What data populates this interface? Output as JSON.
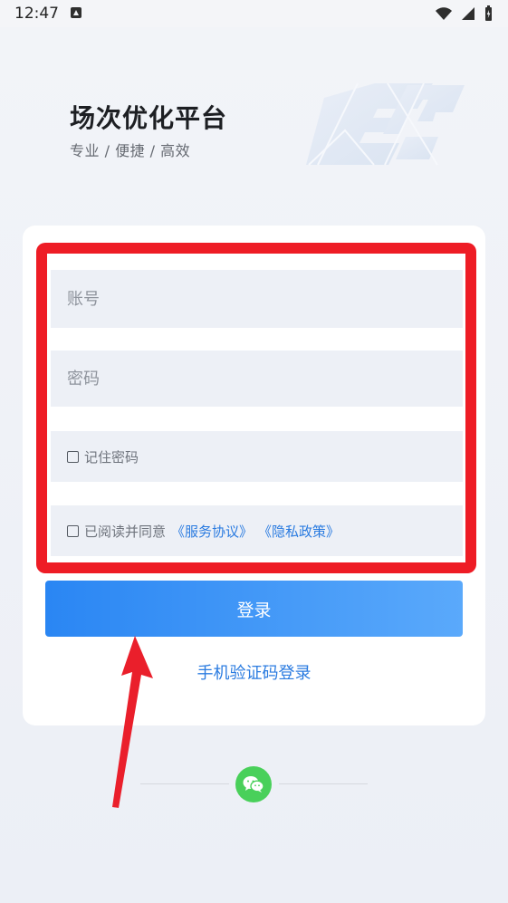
{
  "status_bar": {
    "time": "12:47"
  },
  "brand": {
    "title": "场次优化平台",
    "subtitle": "专业 / 便捷 / 高效"
  },
  "form": {
    "account_placeholder": "账号",
    "password_placeholder": "密码",
    "remember_label": "记住密码",
    "agreement_prefix": "已阅读并同意",
    "service_agreement": "《服务协议》",
    "privacy_policy": "《隐私政策》"
  },
  "actions": {
    "login_label": "登录",
    "sms_login_label": "手机验证码登录"
  },
  "icons": {
    "status_a": "a-icon",
    "wifi": "wifi-icon",
    "signal": "signal-icon",
    "battery": "battery-icon",
    "wechat": "wechat-icon",
    "logo": "ep-logo-watermark"
  },
  "colors": {
    "accent_blue": "#2a7be0",
    "button_start": "#2a86f3",
    "button_end": "#5aa9fb",
    "highlight_red": "#ee1c25",
    "wechat_green": "#49d05a"
  }
}
